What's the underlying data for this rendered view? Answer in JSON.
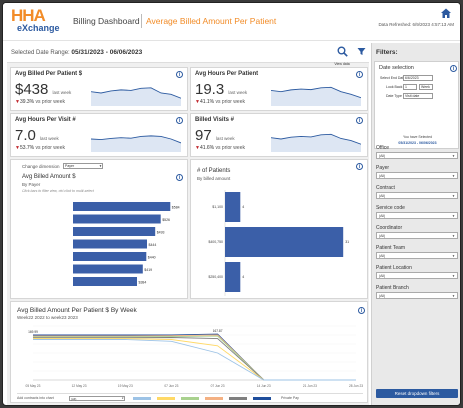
{
  "header": {
    "logo_top": "HHA",
    "logo_bottom": "eXchange",
    "title": "Billing Dashboard",
    "subtitle": "Average Billed Amount Per Patient",
    "refreshed": "Data Refreshed: 6/9/2023 4:57:13 AM"
  },
  "range": {
    "label": "Selected Date Range:",
    "value": "05/31/2023 - 06/06/2023",
    "view_data": "View data"
  },
  "kpis": [
    {
      "title": "Avg Billed Per Patient $",
      "value": "$438",
      "unit": "last week",
      "arrow": "▼",
      "pct": "39.3%",
      "vs": "vs prior week",
      "spark": [
        0.55,
        0.5,
        0.58,
        0.62,
        0.6,
        0.68,
        0.7,
        0.5,
        0.45,
        0.3
      ]
    },
    {
      "title": "Avg Hours Per Patient",
      "value": "19.3",
      "unit": "last week",
      "arrow": "▼",
      "pct": "41.1%",
      "vs": "vs prior week",
      "spark": [
        0.6,
        0.55,
        0.62,
        0.65,
        0.63,
        0.7,
        0.72,
        0.55,
        0.45,
        0.32
      ]
    },
    {
      "title": "Avg Hours Per Visit #",
      "value": "7.0",
      "unit": "last week",
      "arrow": "▼",
      "pct": "53.7%",
      "vs": "vs prior week",
      "spark": [
        0.5,
        0.48,
        0.52,
        0.55,
        0.53,
        0.6,
        0.62,
        0.6,
        0.5,
        0.35
      ]
    },
    {
      "title": "Billed Visits #",
      "value": "97",
      "unit": "last week",
      "arrow": "▼",
      "pct": "41.6%",
      "vs": "vs prior week",
      "spark": [
        0.55,
        0.5,
        0.57,
        0.6,
        0.58,
        0.66,
        0.68,
        0.52,
        0.44,
        0.3
      ]
    }
  ],
  "billed_panel": {
    "change_label": "Change dimension",
    "dimension": "Payer",
    "title": "Avg Billed Amount $",
    "subtitle": "By Payer",
    "hint": "Click bars to filter view, ctrl-click to multi-select",
    "bars": [
      {
        "label": "$584",
        "value": 584
      },
      {
        "label": "$526",
        "value": 526
      },
      {
        "label": "$493",
        "value": 493
      },
      {
        "label": "$444",
        "value": 444
      },
      {
        "label": "$440",
        "value": 440
      },
      {
        "label": "$419",
        "value": 419
      },
      {
        "label": "$384",
        "value": 384
      }
    ]
  },
  "patients_panel": {
    "title": "# of Patients",
    "subtitle": "By billed amount",
    "bars": [
      {
        "category": "$1,100",
        "value": 4,
        "label": "4"
      },
      {
        "category": "$400,750",
        "value": 31,
        "label": "31"
      },
      {
        "category": "$250,400",
        "value": 4,
        "label": "4"
      }
    ]
  },
  "chart_data": {
    "type": "line",
    "title": "Avg Billed Amount Per Patient $ By Week",
    "subtitle": "Week22 2022 to week23 2023",
    "x": [
      "05 May 23",
      "12 May 23",
      "19 May 23",
      "07 Jun 23",
      "07 Jun 23",
      "14 Jun 23",
      "21 Jun 23",
      "28 Jun 23"
    ],
    "series": [
      {
        "values": [
          250,
          250,
          250,
          250,
          255,
          0,
          0,
          0
        ],
        "color": "#1f4e9c"
      },
      {
        "values": [
          245,
          245,
          245,
          246,
          250,
          0,
          0,
          0
        ],
        "color": "#f4b183"
      },
      {
        "values": [
          240,
          240,
          240,
          241,
          244,
          0,
          0,
          0
        ],
        "color": "#a9d18e"
      },
      {
        "values": [
          235,
          235,
          235,
          236,
          230,
          0,
          0,
          0
        ],
        "color": "#7f7f7f"
      },
      {
        "values": [
          230,
          230,
          230,
          225,
          190,
          0,
          0,
          0
        ],
        "color": "#ffd966"
      },
      {
        "values": [
          225,
          225,
          225,
          215,
          150,
          0,
          0,
          0
        ],
        "color": "#9dc3e6"
      }
    ],
    "annotations": [
      "169.99",
      "167.87"
    ],
    "ylim": [
      0,
      300
    ]
  },
  "bottom_legend": {
    "label": "Add contracts into chart",
    "select": "(All)",
    "private_pay": "Private Pay"
  },
  "sidebar": {
    "title": "Filters:",
    "date_box": {
      "title": "Date selection",
      "select_end_label": "Select End Date",
      "select_end_value": "6/6/2023",
      "look_back_label": "Look Back",
      "look_back_value": "1",
      "look_back_unit": "Week",
      "date_type_label": "Date Type",
      "date_type_value": "Visit date",
      "selected_note": "You have Selected",
      "selected_range": "05/31/2023 - 06/06/2023"
    },
    "filters": [
      {
        "label": "Office",
        "value": "(All)"
      },
      {
        "label": "Payer",
        "value": "(All)"
      },
      {
        "label": "Contract",
        "value": "(All)"
      },
      {
        "label": "Service code",
        "value": "(All)"
      },
      {
        "label": "Coordinator",
        "value": "(All)"
      },
      {
        "label": "Patient Team",
        "value": "(All)"
      },
      {
        "label": "Patient Location",
        "value": "(All)"
      },
      {
        "label": "Patient Branch",
        "value": "(All)"
      }
    ],
    "reset": "Reset dropdown filters"
  },
  "colors": {
    "accent": "#f28c28",
    "brand": "#2c5aa0",
    "bar": "#3b5fa8",
    "down": "#c0272d"
  }
}
